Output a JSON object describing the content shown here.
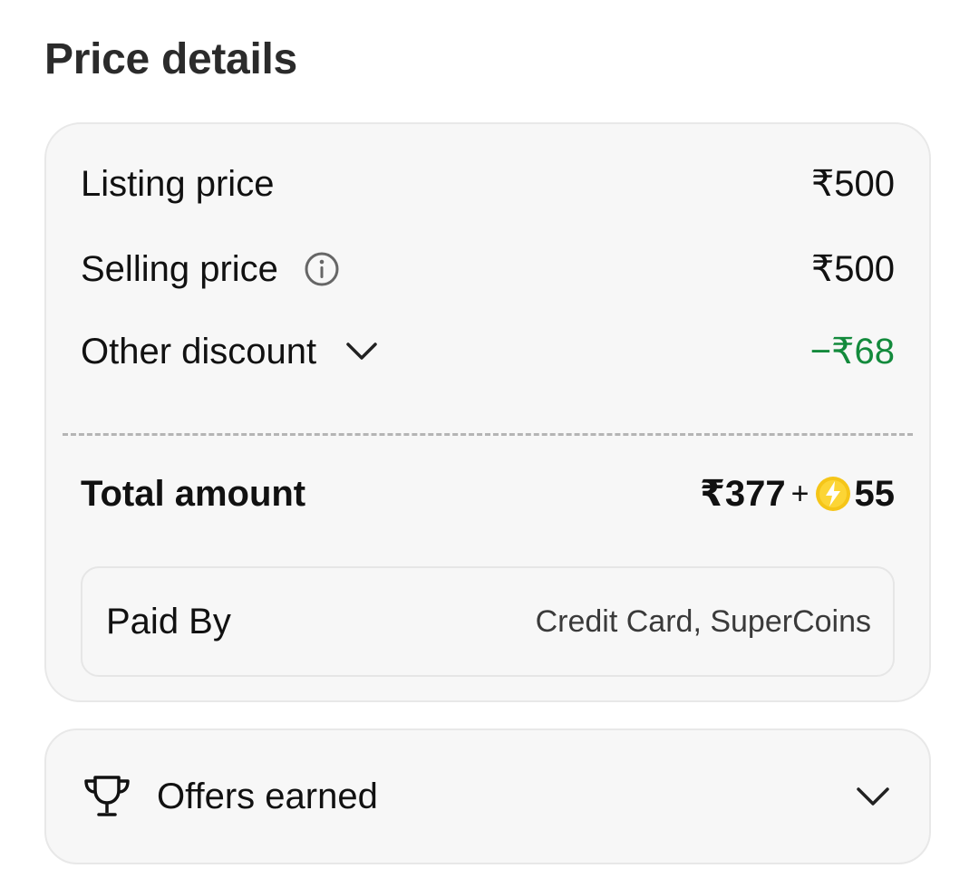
{
  "header": {
    "title": "Price details"
  },
  "price_card": {
    "rows": [
      {
        "label": "Listing price",
        "value": "₹500"
      },
      {
        "label": "Selling price",
        "value": "₹500",
        "icon": "info-icon"
      },
      {
        "label": "Other discount",
        "value": "−₹68",
        "icon": "chevron-down-icon",
        "value_color": "#138a3c"
      }
    ],
    "total": {
      "label": "Total amount",
      "amount": "₹377",
      "plus": "+",
      "coins_icon": "supercoin-icon",
      "coins": "55"
    },
    "paid_by": {
      "label": "Paid By",
      "value": "Credit Card, SuperCoins"
    }
  },
  "offers": {
    "label": "Offers earned",
    "icon": "trophy-icon",
    "expand_icon": "chevron-down-icon"
  },
  "colors": {
    "discount_green": "#138a3c",
    "card_background": "#f7f7f7",
    "coin_yellow": "#f5c518"
  }
}
